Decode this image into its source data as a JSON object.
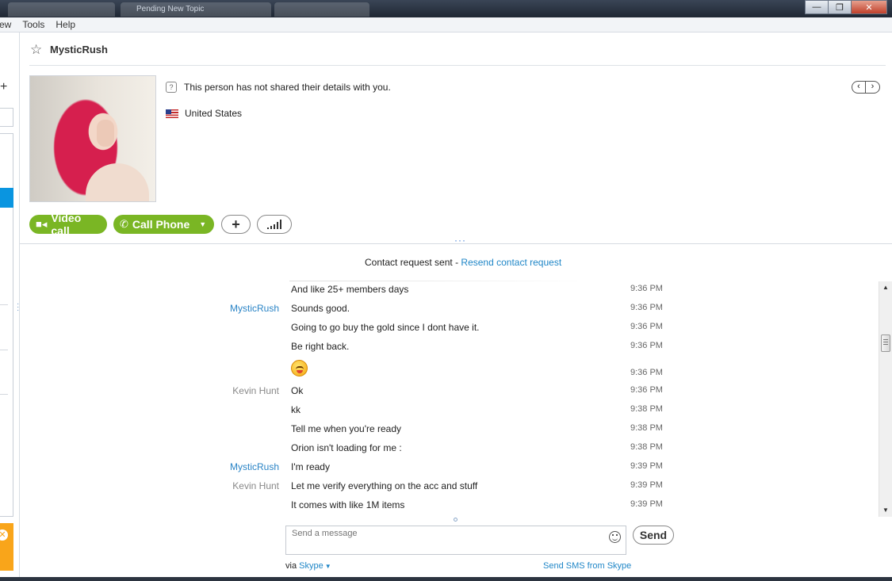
{
  "window": {
    "tabs_ghost": [
      "",
      "Pending New Topic",
      ""
    ],
    "controls": {
      "minimize": "—",
      "restore": "❐",
      "close": "✕"
    }
  },
  "menu": {
    "items": [
      "ew",
      "Tools",
      "Help"
    ]
  },
  "header": {
    "contact_name": "MysticRush",
    "favorite_icon": "star-outline-icon"
  },
  "profile": {
    "details_text": "This person has not shared their details with you.",
    "country": "United States",
    "nav_prev": "‹",
    "nav_next": "›"
  },
  "actions": {
    "video_call": "Video call",
    "call_phone": "Call Phone",
    "add": "+",
    "signal_icon": "call-quality-icon"
  },
  "conversation": {
    "request_text": "Contact request sent - ",
    "resend_link": "Resend contact request",
    "messages": [
      {
        "sender": "",
        "sender_color": "",
        "text": "And like 25+ members days",
        "time": "9:36 PM"
      },
      {
        "sender": "MysticRush",
        "sender_color": "blue",
        "text": "Sounds good.",
        "time": "9:36 PM"
      },
      {
        "sender": "",
        "sender_color": "",
        "text": "Going to go buy the gold since I dont have it.",
        "time": "9:36 PM"
      },
      {
        "sender": "",
        "sender_color": "",
        "text": "Be right back.",
        "time": "9:36 PM"
      },
      {
        "sender": "",
        "sender_color": "",
        "text": "",
        "emoji": "tongue-out-emoticon",
        "time": "9:36 PM"
      },
      {
        "sender": "Kevin Hunt",
        "sender_color": "grey",
        "text": "Ok",
        "time": "9:36 PM"
      },
      {
        "sender": "",
        "sender_color": "",
        "text": "kk",
        "time": "9:38 PM"
      },
      {
        "sender": "",
        "sender_color": "",
        "text": "Tell me when you're ready",
        "time": "9:38 PM"
      },
      {
        "sender": "",
        "sender_color": "",
        "text": "Orion isn't loading for me :",
        "time": "9:38 PM"
      },
      {
        "sender": "MysticRush",
        "sender_color": "blue",
        "text": "I'm ready",
        "time": "9:39 PM"
      },
      {
        "sender": "Kevin Hunt",
        "sender_color": "grey",
        "text": "Let me verify everything on the acc and stuff",
        "time": "9:39 PM"
      },
      {
        "sender": "",
        "sender_color": "",
        "text": "It comes with like 1M items",
        "time": "9:39 PM"
      }
    ]
  },
  "composer": {
    "placeholder": "Send a message",
    "send_label": "Send",
    "via_label": "via ",
    "via_service": "Skype",
    "sms_link": "Send SMS from Skype"
  },
  "colors": {
    "accent_green": "#7ab624",
    "link_blue": "#1f86c7",
    "selection_blue": "#0a95e0",
    "notice_orange": "#f9a51a"
  }
}
